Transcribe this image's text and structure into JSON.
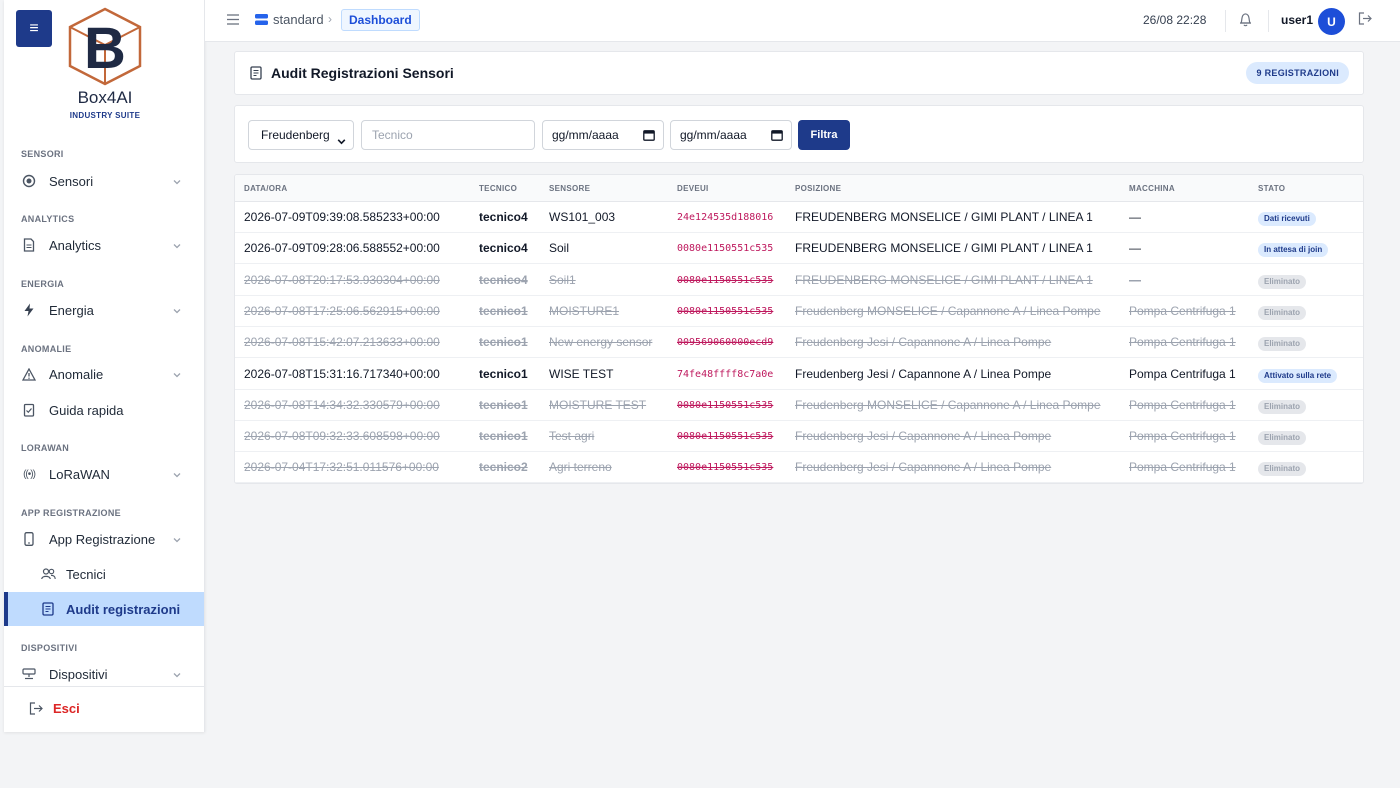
{
  "brand": {
    "name": "Box4AI",
    "suite": "INDUSTRY SUITE"
  },
  "sidebar": {
    "sections": [
      {
        "label": "SENSORI",
        "item": "Sensori"
      },
      {
        "label": "ANALYTICS",
        "item": "Analytics"
      },
      {
        "label": "ENERGIA",
        "item": "Energia"
      },
      {
        "label": "ANOMALIE",
        "item": "Anomalie"
      },
      {
        "label": "LORAWAN",
        "item": "LoRaWAN"
      },
      {
        "label": "APP REGISTRAZIONE",
        "item": "App Registrazione"
      },
      {
        "label": "DISPOSITIVI",
        "item": "Dispositivi"
      }
    ],
    "extra_item": "Guida rapida",
    "sub_items": [
      "Tecnici",
      "Audit registrazioni"
    ],
    "logout": "Esci"
  },
  "topbar": {
    "workspace": "standard",
    "breadcrumb": "Dashboard",
    "datetime": "26/08 22:28",
    "username": "user1",
    "avatar_initial": "U"
  },
  "header": {
    "title": "Audit Registrazioni Sensori",
    "count_badge": "9 REGISTRAZIONI"
  },
  "filters": {
    "company": "Freudenberg",
    "tech_placeholder": "Tecnico",
    "date_from": "gg/mm/aaaa",
    "date_to": "gg/mm/aaaa",
    "submit": "Filtra"
  },
  "table": {
    "columns": [
      "DATA/ORA",
      "TECNICO",
      "SENSORE",
      "DEVEUI",
      "POSIZIONE",
      "MACCHINA",
      "STATO"
    ],
    "rows": [
      {
        "datetime": "2026-07-09T09:39:08.585233+00:00",
        "tech": "tecnico4",
        "sensor": "WS101_003",
        "deveui": "24e124535d188016",
        "position": "FREUDENBERG MONSELICE / GIMI PLANT / LINEA 1",
        "machine": "—",
        "status": "Dati ricevuti",
        "deleted": false
      },
      {
        "datetime": "2026-07-09T09:28:06.588552+00:00",
        "tech": "tecnico4",
        "sensor": "Soil",
        "deveui": "0080e1150551c535",
        "position": "FREUDENBERG MONSELICE / GIMI PLANT / LINEA 1",
        "machine": "—",
        "status": "In attesa di join",
        "deleted": false
      },
      {
        "datetime": "2026-07-08T20:17:53.930304+00:00",
        "tech": "tecnico4",
        "sensor": "Soil1",
        "deveui": "0080e1150551c535",
        "position": "FREUDENBERG MONSELICE / GIMI PLANT / LINEA 1",
        "machine": "—",
        "status": "Eliminato",
        "deleted": true
      },
      {
        "datetime": "2026-07-08T17:25:06.562915+00:00",
        "tech": "tecnico1",
        "sensor": "MOISTURE1",
        "deveui": "0080e1150551c535",
        "position": "Freudenberg MONSELICE / Capannone A / Linea Pompe",
        "machine": "Pompa Centrifuga 1",
        "status": "Eliminato",
        "deleted": true
      },
      {
        "datetime": "2026-07-08T15:42:07.213633+00:00",
        "tech": "tecnico1",
        "sensor": "New energy sensor",
        "deveui": "009569060000ecd9",
        "position": "Freudenberg Jesi / Capannone A / Linea Pompe",
        "machine": "Pompa Centrifuga 1",
        "status": "Eliminato",
        "deleted": true
      },
      {
        "datetime": "2026-07-08T15:31:16.717340+00:00",
        "tech": "tecnico1",
        "sensor": "WISE TEST",
        "deveui": "74fe48ffff8c7a0e",
        "position": "Freudenberg Jesi / Capannone A / Linea Pompe",
        "machine": "Pompa Centrifuga 1",
        "status": "Attivato sulla rete",
        "deleted": false
      },
      {
        "datetime": "2026-07-08T14:34:32.330579+00:00",
        "tech": "tecnico1",
        "sensor": "MOISTURE TEST",
        "deveui": "0080e1150551c535",
        "position": "Freudenberg MONSELICE / Capannone A / Linea Pompe",
        "machine": "Pompa Centrifuga 1",
        "status": "Eliminato",
        "deleted": true
      },
      {
        "datetime": "2026-07-08T09:32:33.608598+00:00",
        "tech": "tecnico1",
        "sensor": "Test agri",
        "deveui": "0080e1150551c535",
        "position": "Freudenberg Jesi / Capannone A / Linea Pompe",
        "machine": "Pompa Centrifuga 1",
        "status": "Eliminato",
        "deleted": true
      },
      {
        "datetime": "2026-07-04T17:32:51.011576+00:00",
        "tech": "tecnico2",
        "sensor": "Agri terreno",
        "deveui": "0080e1150551c535",
        "position": "Freudenberg Jesi / Capannone A / Linea Pompe",
        "machine": "Pompa Centrifuga 1",
        "status": "Eliminato",
        "deleted": true
      }
    ]
  },
  "colors": {
    "primary": "#1e3a8a",
    "active_bg": "#bfdbfe",
    "danger": "#dc2626",
    "deveui": "#be185d"
  }
}
